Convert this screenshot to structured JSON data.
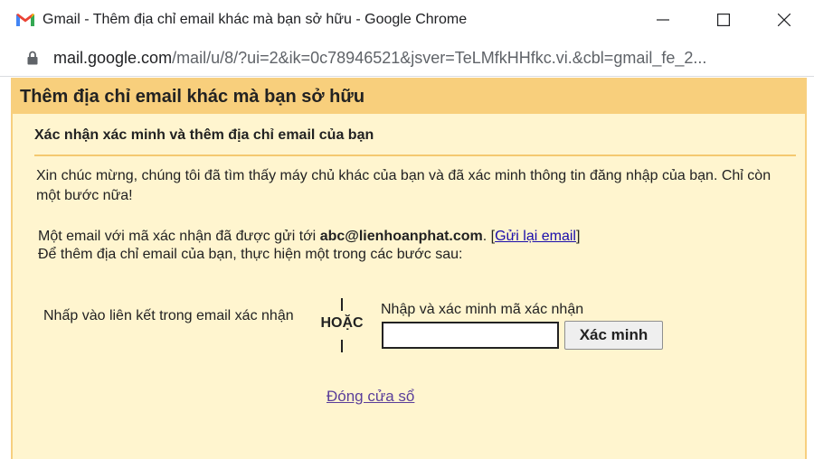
{
  "window": {
    "title": "Gmail - Thêm địa chỉ email khác mà bạn sở hữu - Google Chrome"
  },
  "address": {
    "host": "mail.google.com",
    "path": "/mail/u/8/?ui=2&ik=0c78946521&jsver=TeLMfkHHfkc.vi.&cbl=gmail_fe_2..."
  },
  "dialog": {
    "title": "Thêm địa chỉ email khác mà bạn sở hữu",
    "subtitle": "Xác nhận xác minh và thêm địa chỉ email của bạn",
    "congrats": "Xin chúc mừng, chúng tôi đã tìm thấy máy chủ khác của bạn và đã xác minh thông tin đăng nhập của bạn. Chỉ còn một bước nữa!",
    "sent_prefix": "Một email với mã xác nhận đã được gửi tới ",
    "email": "abc@lienhoanphat.com",
    "sent_suffix": ". [",
    "resend_link": "Gửi lại email",
    "bracket_close": "]",
    "instruction": "Để thêm địa chỉ email của bạn, thực hiện một trong các bước sau:",
    "option_link_text": "Nhấp vào liên kết trong email xác nhận",
    "or_text": "HOẶC",
    "option_code_label": "Nhập và xác minh mã xác nhận",
    "code_value": "",
    "verify_button": "Xác minh",
    "close_link": "Đóng cửa sổ"
  },
  "colors": {
    "header_bg": "#f8cf7c",
    "dialog_bg": "#fff5cf",
    "link": "#1a0dab",
    "visited_link": "#5a3e9a"
  },
  "icons": {
    "app": "gmail-icon",
    "lock": "lock-icon",
    "minimize": "minimize-icon",
    "maximize": "maximize-icon",
    "close": "close-icon"
  }
}
